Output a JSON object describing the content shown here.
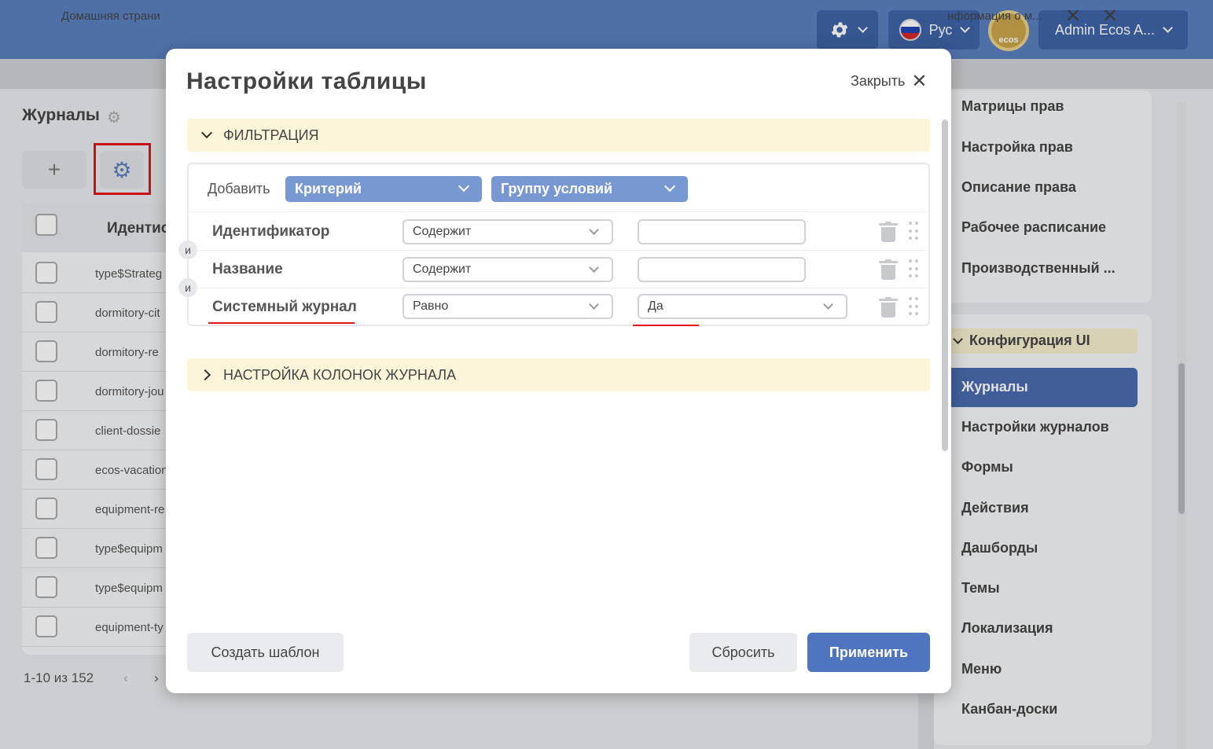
{
  "header": {
    "language": "Рус",
    "user": "Admin Ecos A...",
    "logo_text": "ecos"
  },
  "tabs": {
    "left": "Домашняя страни",
    "right": "нформация о м..."
  },
  "background": {
    "page_title": "Журналы",
    "column_header": "Идентис",
    "rows": [
      "type$Strateg",
      "dormitory-cit",
      "dormitory-re",
      "dormitory-jou",
      "client-dossie",
      "ecos-vacation",
      "equipment-re",
      "type$equipm",
      "type$equipm",
      "equipment-ty"
    ],
    "pagination": "1-10 из 152"
  },
  "sidebar": {
    "items_top": [
      "Матрицы прав",
      "Настройка прав",
      "Описание права",
      "Рабочее расписание",
      "Производственный ..."
    ],
    "group": "Конфигурация UI",
    "active": "Журналы",
    "items": [
      "Настройки журналов",
      "Формы",
      "Действия",
      "Дашборды",
      "Темы",
      "Локализация",
      "Меню",
      "Канбан-доски"
    ]
  },
  "modal": {
    "title": "Настройки таблицы",
    "close_label": "Закрыть",
    "filter_section": "ФИЛЬТРАЦИЯ",
    "add_label": "Добавить",
    "add_criterion": "Критерий",
    "add_group": "Группу условий",
    "and_label": "и",
    "filters": [
      {
        "field": "Идентификатор",
        "operator": "Содержит",
        "value": ""
      },
      {
        "field": "Название",
        "operator": "Содержит",
        "value": ""
      },
      {
        "field": "Системный журнал",
        "operator": "Равно",
        "value": "Да"
      }
    ],
    "columns_section": "НАСТРОЙКА КОЛОНОК ЖУРНАЛА",
    "create_template": "Создать шаблон",
    "reset": "Сбросить",
    "apply": "Применить"
  },
  "colors": {
    "header_bg": "#5b7fbf",
    "accent": "#4f74c0",
    "section_bg": "#fdf5d9",
    "highlight": "#e8141a"
  }
}
